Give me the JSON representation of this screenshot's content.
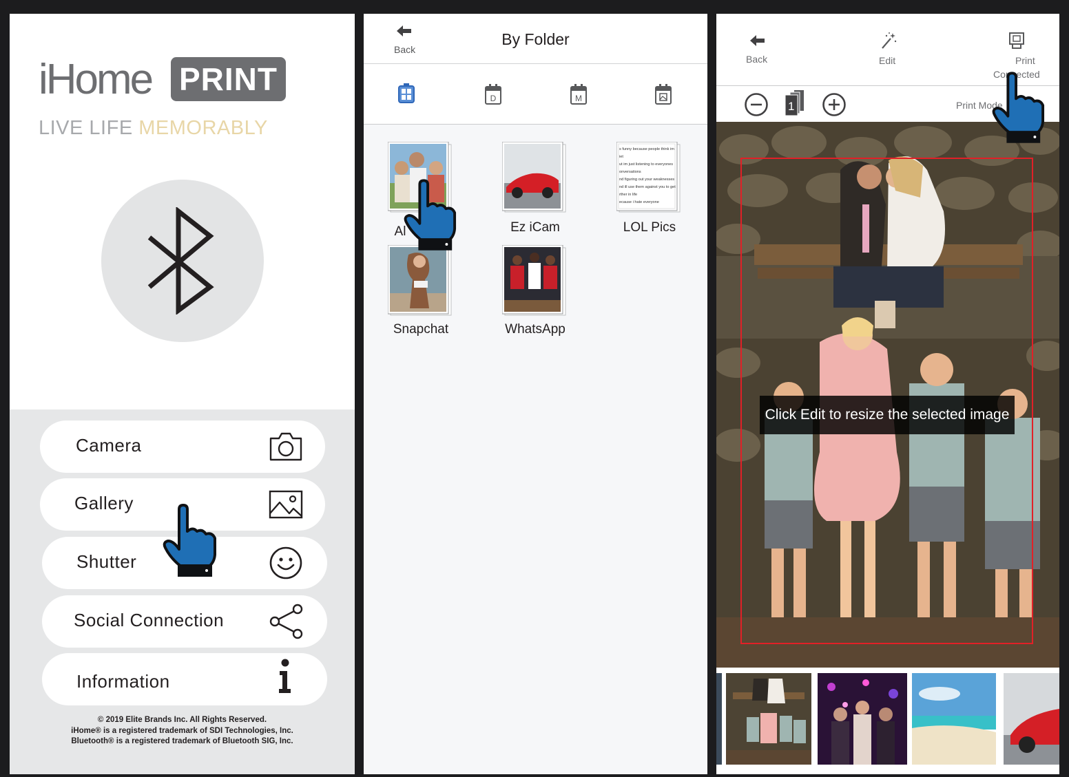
{
  "home": {
    "logo_ihome": "iHome",
    "logo_print": "PRINT",
    "tagline_a": "LIVE LIFE ",
    "tagline_b": "MEMORABLY",
    "menu": [
      {
        "label": "Camera",
        "icon": "camera-icon"
      },
      {
        "label": "Gallery",
        "icon": "image-icon"
      },
      {
        "label": "Shutter",
        "icon": "smiley-icon"
      },
      {
        "label": "Social Connection",
        "icon": "share-icon"
      },
      {
        "label": "Information",
        "icon": "info-icon"
      }
    ],
    "copyright": [
      "© 2019 Elite Brands Inc. All Rights Reserved.",
      "iHome® is a registered trademark of SDI Technologies, Inc.",
      "Bluetooth® is a registered trademark of Bluetooth SIG, Inc."
    ]
  },
  "folder": {
    "back_label": "Back",
    "title": "By Folder",
    "tabs": [
      {
        "icon": "folder-grid-icon"
      },
      {
        "icon": "calendar-day-icon",
        "letter": "D"
      },
      {
        "icon": "calendar-month-icon",
        "letter": "M"
      },
      {
        "icon": "calendar-image-icon"
      }
    ],
    "folders": [
      {
        "label": "All Photos",
        "visible_label": "Al"
      },
      {
        "label": "Ez iCam"
      },
      {
        "label": "LOL Pics"
      },
      {
        "label": "Snapchat"
      },
      {
        "label": "WhatsApp"
      }
    ],
    "lol_text": [
      "s funny because people think im",
      "iet",
      "ut im just listening to everyones",
      "onversations",
      "nd figuring out your weaknesses",
      "nd ill use them against you to get",
      "rther in life",
      "ecause i hate everyone"
    ]
  },
  "editor": {
    "back_label": "Back",
    "edit_label": "Edit",
    "print_label": "Print",
    "connected_label": "Connected",
    "print_mode_label": "Print Mode",
    "copies": "1",
    "tooltip": "Click Edit to resize the selected image"
  },
  "colors": {
    "accent_blue": "#1f6fb5",
    "logo_gray": "#6d6e71",
    "tag_gold": "#e8d6a7",
    "select_red": "#e22027"
  }
}
